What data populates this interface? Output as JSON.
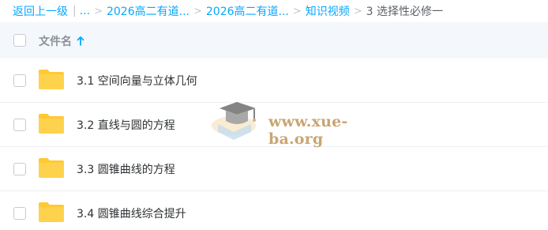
{
  "breadcrumb": {
    "back": "返回上一级",
    "ellipsis": "...",
    "items": [
      "2026高二有道...",
      "2026高二有道...",
      "知识视频"
    ],
    "current": "3 选择性必修一"
  },
  "header": {
    "column_label": "文件名",
    "sort_icon": "arrow-up-icon"
  },
  "rows": [
    {
      "name": "3.1 空间向量与立体几何"
    },
    {
      "name": "3.2 直线与圆的方程"
    },
    {
      "name": "3.3 圆锥曲线的方程"
    },
    {
      "name": "3.4 圆锥曲线综合提升"
    }
  ],
  "watermark": {
    "text": "www.xue-ba.org"
  },
  "colors": {
    "accent": "#06a7ff",
    "folder": "#ffd24d",
    "header_bg": "#f4f8fd",
    "watermark": "#c9a572"
  }
}
